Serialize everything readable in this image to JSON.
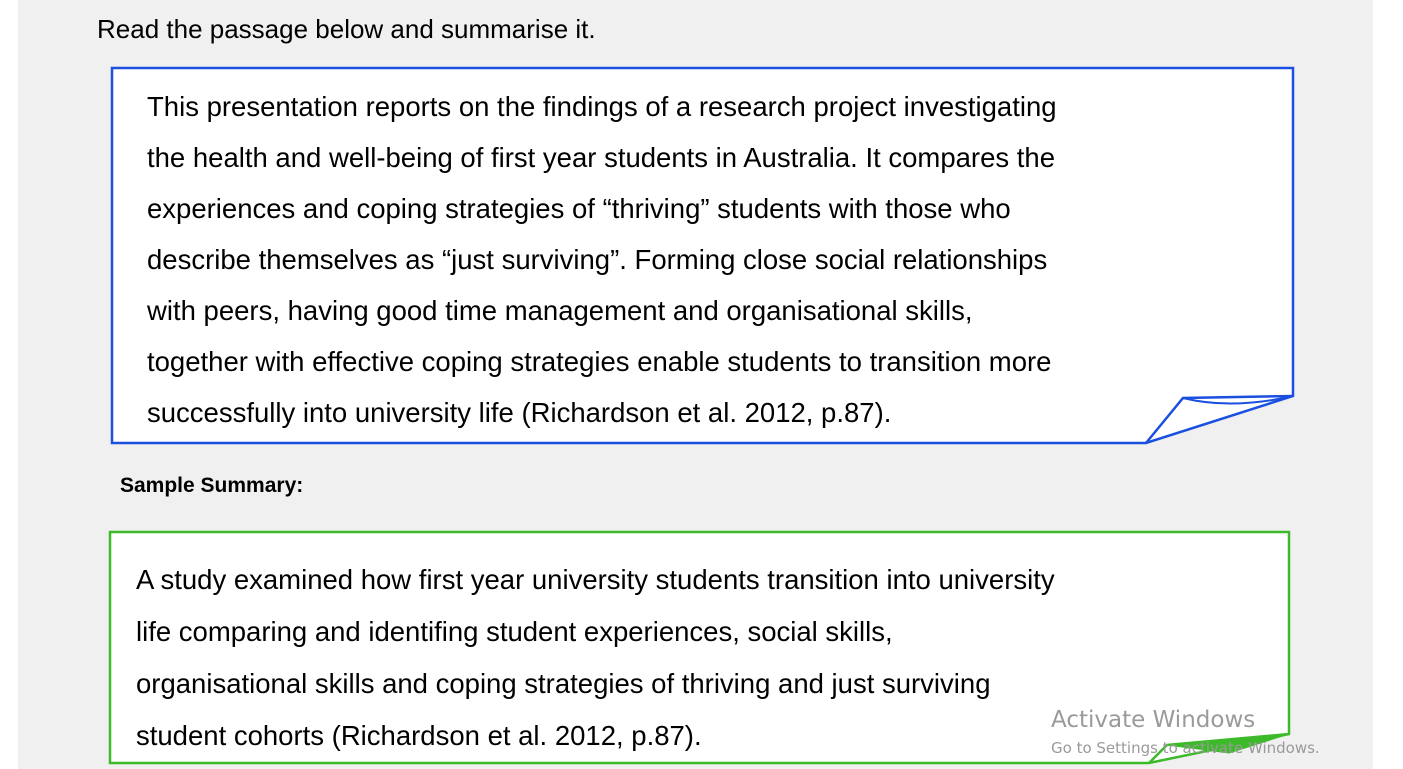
{
  "instruction": "Read the passage below and summarise it.",
  "passage": {
    "lines": [
      "This presentation reports on the findings of a research project investigating",
      "the health and well-being of first year students in Australia. It compares the",
      "experiences and coping strategies of “thriving” students with those who",
      "describe themselves as “just surviving”. Forming close social relationships",
      "with peers, having good time management and organisational skills,",
      "together with effective coping strategies enable students to transition more",
      "successfully into university life (Richardson et al. 2012, p.87)."
    ],
    "border_color": "#1a4fe0"
  },
  "summary": {
    "heading": "Sample Summary:",
    "lines": [
      "A study examined how first year university students transition into university",
      "life comparing and identifing student experiences, social skills,",
      "organisational skills and coping strategies of thriving and just surviving",
      "student cohorts (Richardson et al. 2012, p.87)."
    ],
    "border_color": "#3dba2a"
  },
  "watermark": {
    "title": "Activate Windows",
    "subtitle": "Go to Settings to activate Windows."
  }
}
